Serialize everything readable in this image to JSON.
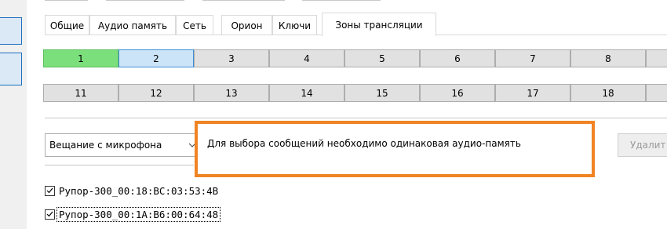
{
  "tabs": [
    "Общие",
    "Аудио память",
    "Сеть",
    "Орион",
    "Ключи",
    "Зоны трансляции"
  ],
  "active_tab_index": 5,
  "zones_row1": [
    "1",
    "2",
    "3",
    "4",
    "5",
    "6",
    "7",
    "8"
  ],
  "zones_row2": [
    "11",
    "12",
    "13",
    "14",
    "15",
    "16",
    "17",
    "18"
  ],
  "zone_states": {
    "1": "active-green",
    "2": "selected-blue"
  },
  "broadcast_mode": {
    "value": "Вещание с микрофона",
    "arrow": "chevron-down-icon"
  },
  "message": "Для выбора сообщений необходимо одинаковая аудио-память",
  "delete_label": "Удалит",
  "devices": [
    {
      "label": "Рупор-300_00:18:BC:03:53:4B",
      "checked": true
    },
    {
      "label": "Рупор-300_00:1A:B6:00:64:48",
      "checked": true
    }
  ],
  "colors": {
    "highlight": "#f08424",
    "zone_green": "#7be07b",
    "zone_blue": "#cce4f7"
  }
}
